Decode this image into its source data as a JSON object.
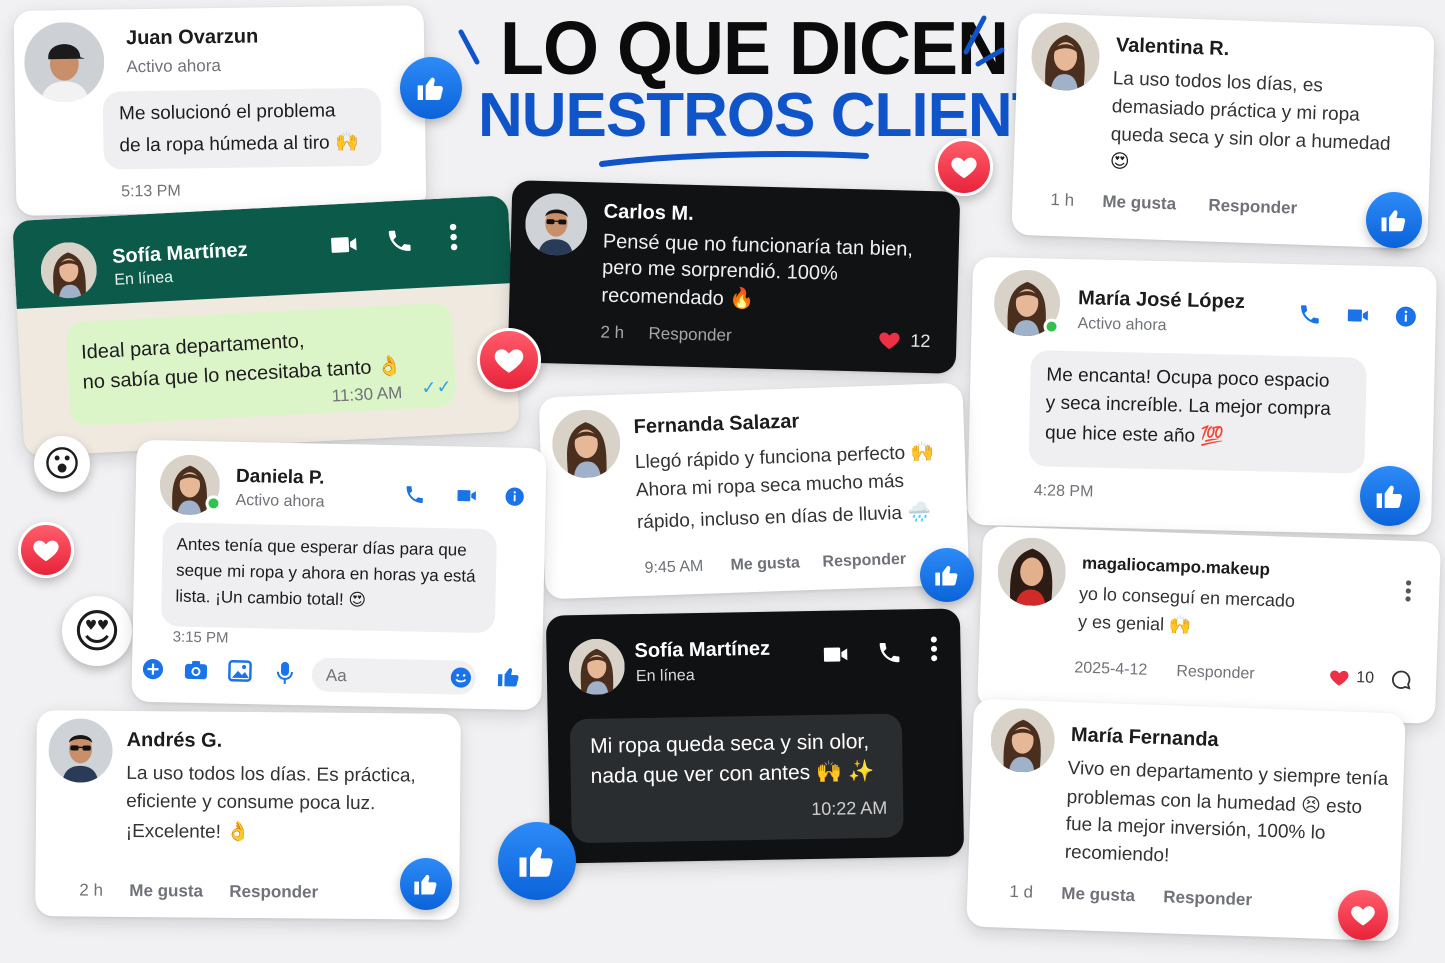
{
  "headline": {
    "line1": "LO QUE DICEN",
    "line2": "NUESTROS CLIENTES"
  },
  "colors": {
    "brand_blue": "#0f54c9",
    "whatsapp_green": "#0b5a4a",
    "like_blue": "#1a73e8",
    "heart_red": "#ef2f45"
  },
  "cards": {
    "juan": {
      "name": "Juan Ovarzun",
      "status": "Activo ahora",
      "line1": "Me solucionó el problema",
      "line2": "de la ropa húmeda al tiro 🙌",
      "time": "5:13 PM"
    },
    "sofia_wa": {
      "name": "Sofía Martínez",
      "status": "En línea",
      "line1": "Ideal para departamento,",
      "line2": "no sabía que lo necesitaba tanto 👌",
      "time": "11:30 AM"
    },
    "carlos": {
      "name": "Carlos M.",
      "line1": "Pensé que no funcionaría tan bien,",
      "line2": "pero me sorprendió. 100%",
      "line3": "recomendado 🔥",
      "time": "2 h",
      "reply": "Responder",
      "likes": "12"
    },
    "valentina": {
      "name": "Valentina R.",
      "line1": "La uso todos los días, es",
      "line2": "demasiado práctica y mi ropa",
      "line3": "queda seca y sin olor a humedad",
      "line4": "😍",
      "time": "1 h",
      "like": "Me gusta",
      "reply": "Responder"
    },
    "mariajose": {
      "name": "María José López",
      "status": "Activo ahora",
      "line1": "Me encanta! Ocupa poco espacio",
      "line2": "y seca increíble. La mejor compra",
      "line3": "que hice este año 💯",
      "time": "4:28 PM"
    },
    "fernanda": {
      "name": "Fernanda Salazar",
      "line1": "Llegó rápido y funciona perfecto 🙌",
      "line2": "Ahora mi ropa seca mucho más",
      "line3": "rápido, incluso en días de lluvia 🌧️",
      "time": "9:45 AM",
      "like": "Me gusta",
      "reply": "Responder"
    },
    "daniela": {
      "name": "Daniela P.",
      "status": "Activo ahora",
      "line1": "Antes tenía que esperar días para que",
      "line2": "seque mi ropa y ahora en horas ya está",
      "line3": "lista. ¡Un cambio total! 😍",
      "time": "3:15 PM",
      "input_placeholder": "Aa"
    },
    "magali": {
      "name": "magaliocampo.makeup",
      "line1": "yo lo conseguí en mercado",
      "line2": "y es genial 🙌",
      "date": "2025-4-12",
      "reply": "Responder",
      "likes": "10"
    },
    "sofia_dark": {
      "name": "Sofía Martínez",
      "status": "En línea",
      "line1": "Mi ropa queda seca y sin olor,",
      "line2": "nada que ver con antes 🙌 ✨",
      "time": "10:22 AM"
    },
    "andres": {
      "name": "Andrés G.",
      "line1": "La uso todos los días. Es práctica,",
      "line2": "eficiente y consume poca luz.",
      "line3": "¡Excelente! 👌",
      "time": "2 h",
      "like": "Me gusta",
      "reply": "Responder"
    },
    "mariafernanda": {
      "name": "María Fernanda",
      "line1": "Vivo en departamento y siempre tenía",
      "line2": "problemas con la humedad 😣 esto",
      "line3": "fue la mejor inversión, 100% lo",
      "line4": "recomiendo!",
      "time": "1 d",
      "like": "Me gusta",
      "reply": "Responder"
    }
  }
}
